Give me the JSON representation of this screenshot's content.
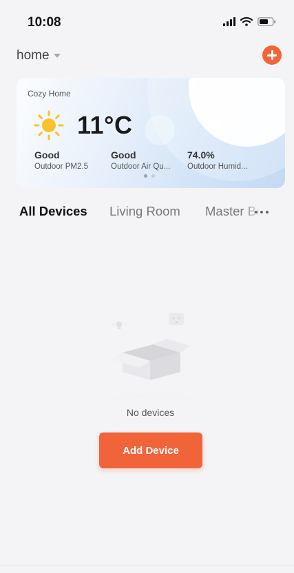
{
  "status_bar": {
    "time": "10:08"
  },
  "header": {
    "home_label": "home"
  },
  "weather_card": {
    "title": "Cozy Home",
    "temperature": "11°C",
    "metrics": [
      {
        "value": "Good",
        "label": "Outdoor PM2.5"
      },
      {
        "value": "Good",
        "label": "Outdoor Air Qu..."
      },
      {
        "value": "74.0%",
        "label": "Outdoor Humid..."
      }
    ],
    "pager": {
      "pages": 2,
      "active": 1
    }
  },
  "room_tabs": {
    "items": [
      {
        "label": "All Devices",
        "active": true
      },
      {
        "label": "Living Room",
        "active": false
      },
      {
        "label": "Master Be",
        "active": false
      }
    ]
  },
  "empty_state": {
    "message": "No devices"
  },
  "actions": {
    "add_device_label": "Add Device"
  },
  "icons": {
    "signal": "signal-icon",
    "wifi": "wifi-icon",
    "battery": "battery-icon",
    "dropdown": "caret-down-icon",
    "add": "plus-icon",
    "weather": "sun-icon",
    "more": "more-icon"
  },
  "colors": {
    "accent": "#f1643a",
    "sun": "#f8c22a",
    "background": "#f4f4f6"
  }
}
